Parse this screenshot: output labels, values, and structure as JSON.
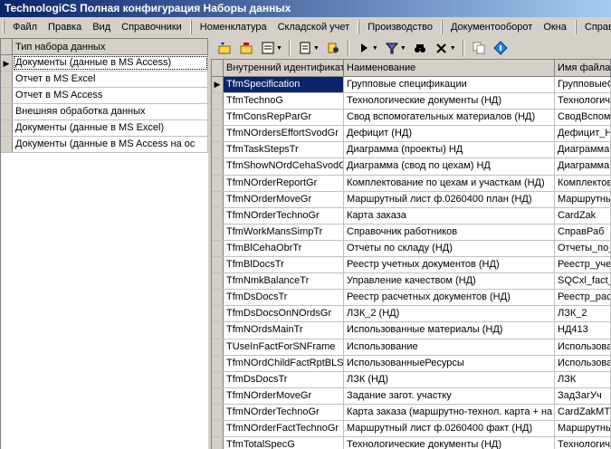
{
  "window": {
    "title": "TechnologiCS Полная конфигурация Наборы данных"
  },
  "menu": [
    "Файл",
    "Правка",
    "Вид",
    "Справочники",
    "Номенклатура",
    "Складской учет",
    "Производство",
    "Документооборот",
    "Окна",
    "Справка"
  ],
  "toolbar": {
    "icons": [
      "new-record-icon",
      "open-record-icon",
      "save-icon",
      "dropdown-icon",
      "document-icon",
      "dropdown-icon",
      "tools-icon",
      "run-icon",
      "dropdown-icon",
      "filter-icon",
      "dropdown-icon",
      "find-icon",
      "settings-icon",
      "dropdown-icon",
      "copy-icon",
      "properties-icon"
    ]
  },
  "left_table": {
    "header": "Тип набора данных",
    "rows": [
      "Документы (данные в MS Access)",
      "Отчет в MS Excel",
      "Отчет в MS Access",
      "Внешняя обработка данных",
      "Документы (данные в MS Excel)",
      "Документы (данные в MS Access на ос"
    ],
    "selected_index": 0
  },
  "grid": {
    "headers": [
      "Внутренний идентификат",
      "Наименование",
      "Имя файла"
    ],
    "rows": [
      [
        "TfmSpecification",
        "Групповые спецификации",
        "ГрупповыеС"
      ],
      [
        "TfmTechnoG",
        "Технологические документы (НД)",
        "Технологиче"
      ],
      [
        "TfmConsRepParGr",
        "Свод вспомогательных материалов (НД)",
        "СводВспомо"
      ],
      [
        "TfmNOrdersEffortSvodGr",
        "Дефицит (НД)",
        "Дефицит_Н"
      ],
      [
        "TfmTaskStepsTr",
        "Диаграмма (проекты) НД",
        "Диаграмма"
      ],
      [
        "TfmShowNOrdCehaSvodG",
        "Диаграмма (свод по цехам) НД",
        "Диаграмма"
      ],
      [
        "TfmNOrderReportGr",
        "Комплектование по цехам и участкам (НД)",
        "Комплектов"
      ],
      [
        "TfmNOrderMoveGr",
        "Маршрутный лист ф.0260400 план (НД)",
        "Маршрутны"
      ],
      [
        "TfmNOrderTechnoGr",
        "Карта заказа",
        "CardZak"
      ],
      [
        "TfmWorkMansSimpTr",
        "Справочник работников",
        "СправРаб"
      ],
      [
        "TfmBlCehaObrTr",
        "Отчеты по складу (НД)",
        "Отчеты_по_"
      ],
      [
        "TfmBlDocsTr",
        "Реестр учетных документов (НД)",
        "Реестр_уче"
      ],
      [
        "TfmNmkBalanceTr",
        "Управление качеством (НД)",
        "SQCxl_fact_"
      ],
      [
        "TfmDsDocsTr",
        "Реестр расчетных документов (НД)",
        "Реестр_рас"
      ],
      [
        "TfmDsDocsOnNOrdsGr",
        "ЛЗК_2 (НД)",
        "ЛЗК_2"
      ],
      [
        "TfmNOrdsMainTr",
        "Использованные материалы (НД)",
        "НД413"
      ],
      [
        "TUseInFactForSNFrame",
        "Использование",
        "Использова"
      ],
      [
        "TfmNOrdChildFactRptBLS",
        "ИспользованныеРесурсы",
        "Использова"
      ],
      [
        "TfmDsDocsTr",
        "ЛЗК (НД)",
        "ЛЗК"
      ],
      [
        "TfmNOrderMoveGr",
        "Задание загот. участку",
        "ЗадЗагУч"
      ],
      [
        "TfmNOrderTechnoGr",
        "Карта заказа (маршрутно-технол. карта + на",
        "CardZakMTK"
      ],
      [
        "TfmNOrderFactTechnoGr",
        "Маршрутный лист ф.0260400 факт (НД)",
        "Маршрутны"
      ],
      [
        "TfmTotalSpecG",
        "Технологические документы (НД)",
        "Технологиче"
      ]
    ],
    "selected_index": 0
  },
  "colors": {
    "title_start": "#0a246a",
    "title_end": "#a6caf0",
    "face": "#d4d0c8",
    "selection": "#0a246a"
  }
}
